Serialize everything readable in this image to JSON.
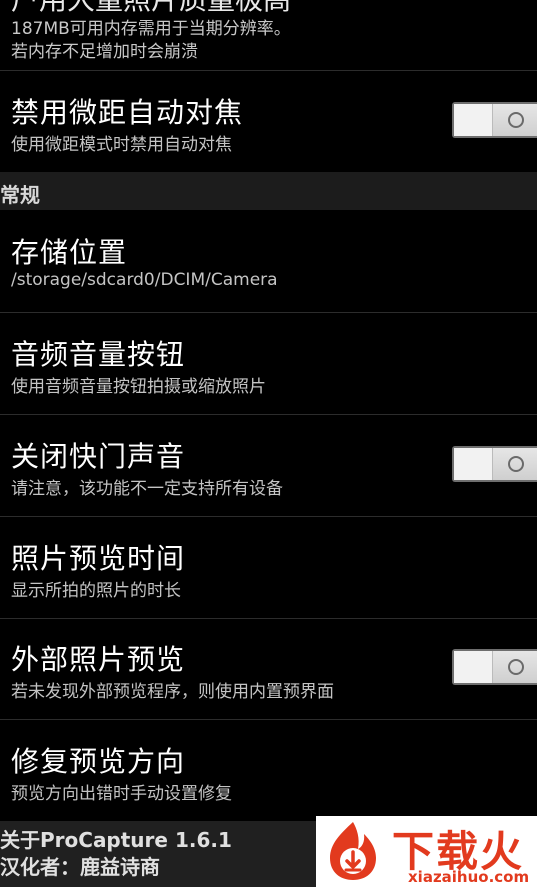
{
  "partial_item": {
    "title_cutoff": "户用大量照片质量极高",
    "summary_line1": "187MB可用内存需用于当期分辨率。",
    "summary_line2": "若内存不足增加时会崩溃"
  },
  "items_top": [
    {
      "title": "禁用微距自动对焦",
      "summary": "使用微距模式时禁用自动对焦",
      "toggle": false
    }
  ],
  "section_general": "常规",
  "items": [
    {
      "title": "存储位置",
      "summary": "/storage/sdcard0/DCIM/Camera"
    },
    {
      "title": "音频音量按钮",
      "summary": "使用音频音量按钮拍摄或缩放照片"
    },
    {
      "title": "关闭快门声音",
      "summary": "请注意，该功能不一定支持所有设备",
      "toggle": false
    },
    {
      "title": "照片预览时间",
      "summary": "显示所拍的照片的时长"
    },
    {
      "title": "外部照片预览",
      "summary": "若未发现外部预览程序，则使用内置预界面",
      "toggle": false
    },
    {
      "title": "修复预览方向",
      "summary": "预览方向出错时手动设置修复"
    }
  ],
  "footer": {
    "about": "关于ProCapture 1.6.1",
    "translator": "汉化者：鹿益诗商"
  },
  "watermark": {
    "brand": "下载火",
    "url": "xiazaihuo.com",
    "color": "#e23a1e"
  }
}
